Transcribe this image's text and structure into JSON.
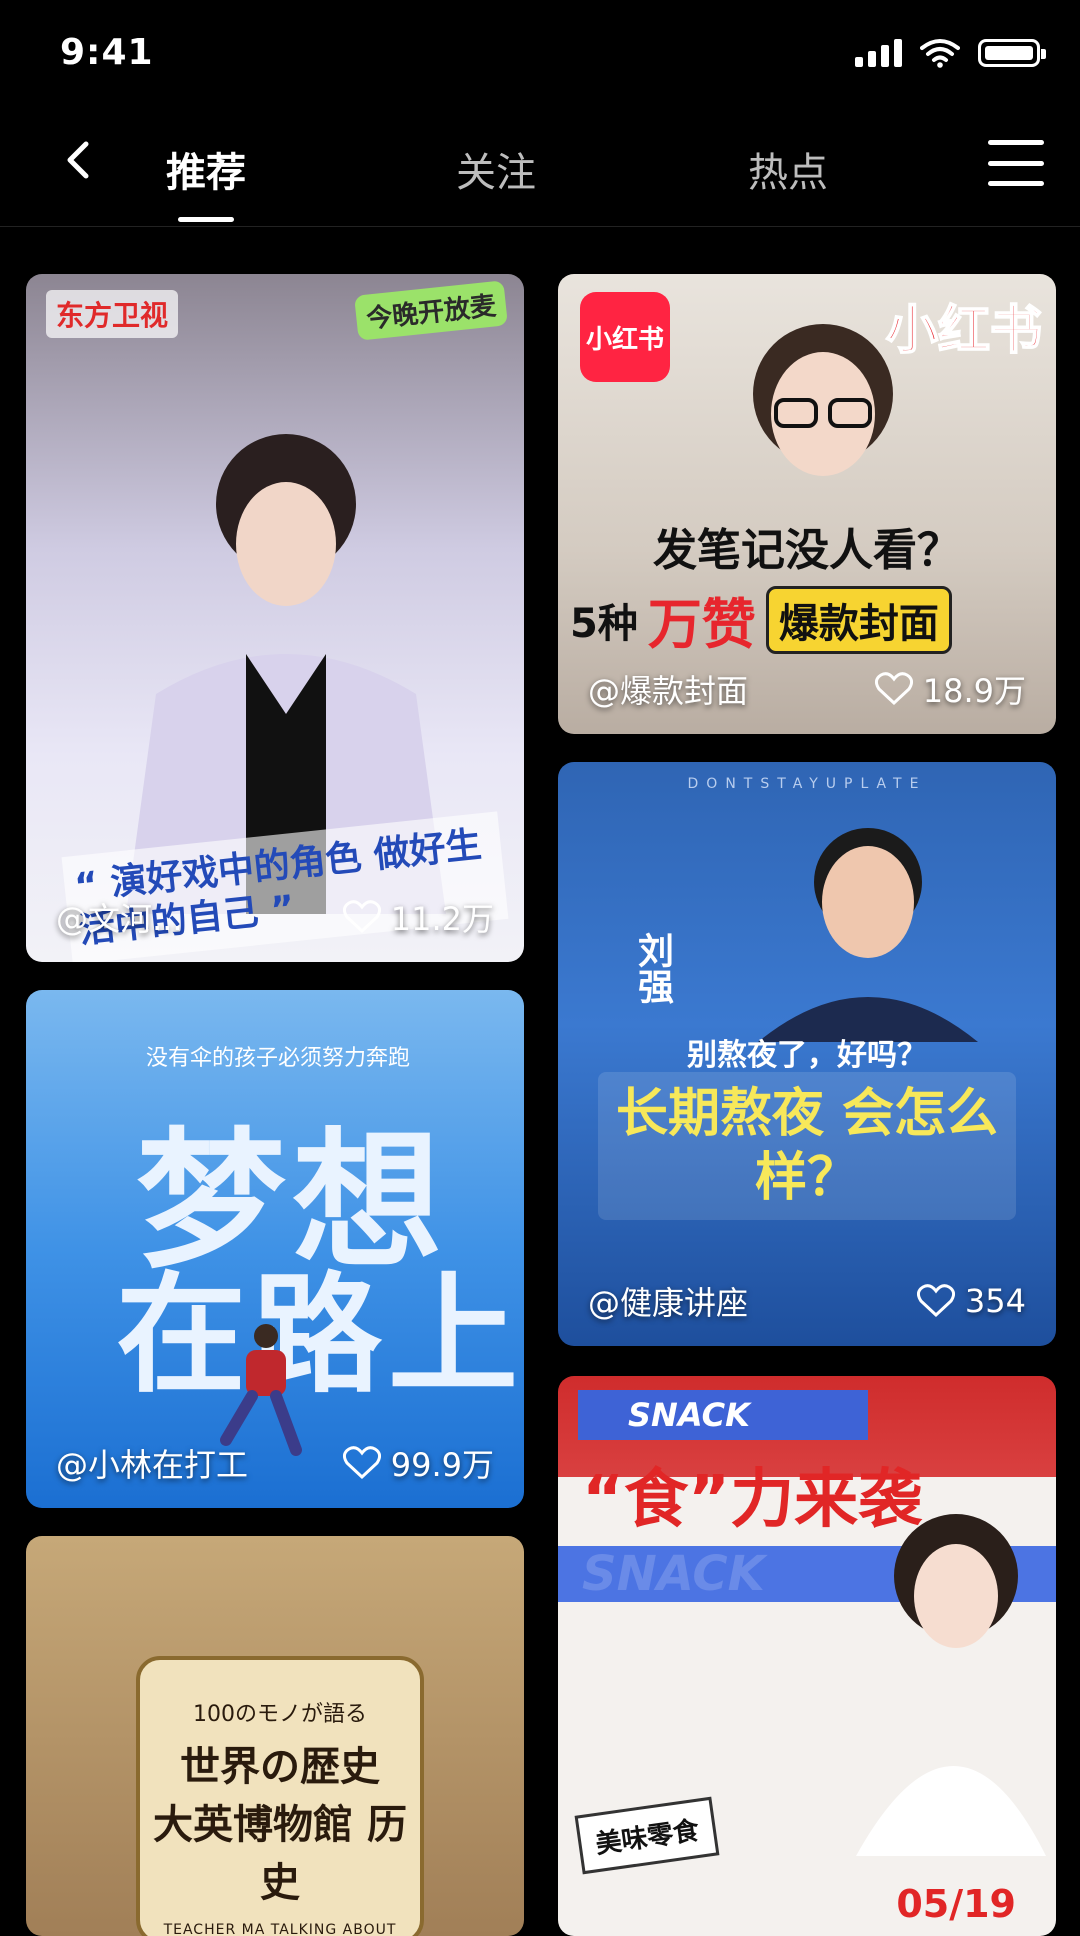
{
  "status_bar": {
    "time": "9:41"
  },
  "header": {
    "tabs": [
      {
        "label": "推荐",
        "active": true
      },
      {
        "label": "关注",
        "active": false
      },
      {
        "label": "热点",
        "active": false
      }
    ]
  },
  "feed": {
    "cards": [
      {
        "id": "c1",
        "author": "@文河...",
        "likes": "11.2万",
        "brand": "东方卫视",
        "show": "今晚开放麦",
        "quote": "“ 演好戏中的角色 做好生活中的自己 ”"
      },
      {
        "id": "c2",
        "author": "@爆款封面",
        "likes": "18.9万",
        "logo": "小红书",
        "tag": "小红书",
        "line1": "发笔记没人看？",
        "line2_pre": "5种",
        "line2_red": "万赞",
        "line2_pill": "爆款封面"
      },
      {
        "id": "c3",
        "author": "@小林在打工",
        "likes": "99.9万",
        "sub": "没有伞的孩子必须努力奔跑",
        "title1": "梦想",
        "title2": "在路上"
      },
      {
        "id": "c4",
        "author": "@健康讲座",
        "likes": "354",
        "top_text": "DONTSTAYUPLATE",
        "name": "刘强",
        "ask": "别熬夜了，好吗？",
        "big": "长期熬夜 会怎么样？"
      },
      {
        "id": "c5",
        "p1": "100のモノが語る",
        "p2": "世界の歴史",
        "p3": "大英博物館 历史",
        "p4": "TEACHER MA TALKING ABOUT HISTORY"
      },
      {
        "id": "c6",
        "snack": "SNACK",
        "head": "“食”力来袭",
        "ribbon": "SNACK",
        "label": "美味零食",
        "date": "05/19"
      }
    ]
  },
  "colors": {
    "background": "#000000",
    "accent_red": "#ff2442",
    "tab_inactive": "#bdbdbd"
  },
  "icons": [
    "back-chevron-icon",
    "menu-icon",
    "signal-icon",
    "wifi-icon",
    "battery-icon",
    "heart-icon"
  ]
}
